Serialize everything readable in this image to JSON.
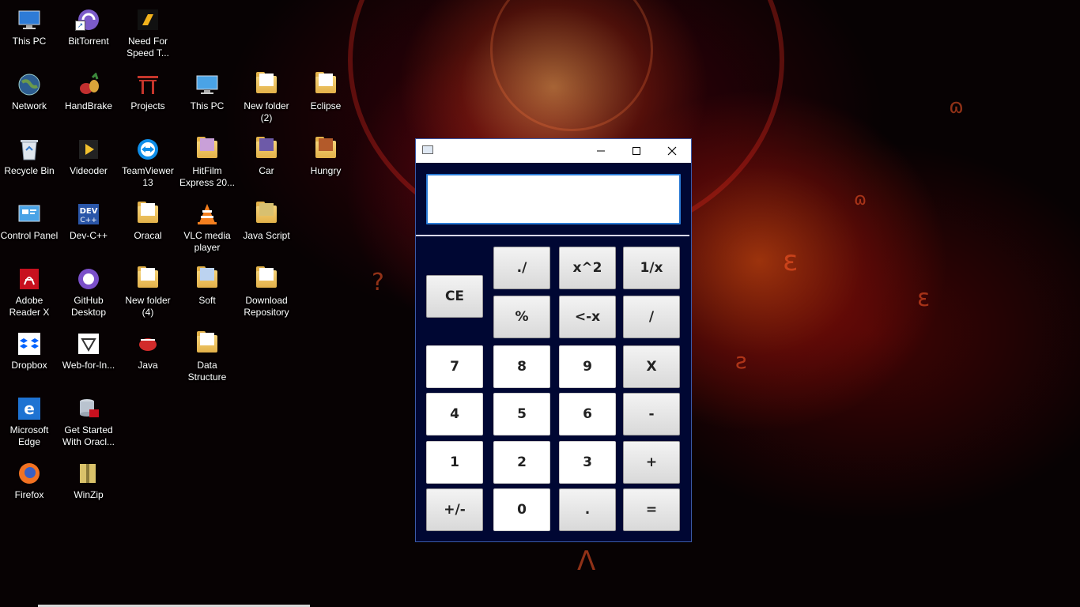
{
  "desktop": {
    "icons": [
      {
        "label": "This PC",
        "icon": "monitor-icon"
      },
      {
        "label": "BitTorrent",
        "icon": "bittorrent-icon"
      },
      {
        "label": "Need For Speed T...",
        "icon": "nfs-icon"
      },
      {
        "label": "Network",
        "icon": "network-globe-icon"
      },
      {
        "label": "HandBrake",
        "icon": "handbrake-icon"
      },
      {
        "label": "Projects",
        "icon": "gate-icon"
      },
      {
        "label": "This PC",
        "icon": "monitor-icon"
      },
      {
        "label": "New folder (2)",
        "icon": "folder-icon"
      },
      {
        "label": "Eclipse",
        "icon": "folder-icon"
      },
      {
        "label": "Recycle Bin",
        "icon": "recycle-bin-icon"
      },
      {
        "label": "Videoder",
        "icon": "videoder-icon"
      },
      {
        "label": "TeamViewer 13",
        "icon": "teamviewer-icon"
      },
      {
        "label": "HitFilm Express 20...",
        "icon": "folder-icon"
      },
      {
        "label": "Car",
        "icon": "folder-icon"
      },
      {
        "label": "Hungry",
        "icon": "folder-icon"
      },
      {
        "label": "Control Panel",
        "icon": "control-panel-icon"
      },
      {
        "label": "Dev-C++",
        "icon": "devcpp-icon"
      },
      {
        "label": "Oracal",
        "icon": "folder-icon"
      },
      {
        "label": "VLC media player",
        "icon": "vlc-icon"
      },
      {
        "label": "Java Script",
        "icon": "folder-icon"
      },
      {
        "label": "Adobe Reader X",
        "icon": "adobe-reader-icon"
      },
      {
        "label": "GitHub Desktop",
        "icon": "github-icon"
      },
      {
        "label": "New folder (4)",
        "icon": "folder-icon"
      },
      {
        "label": "Soft",
        "icon": "folder-icon"
      },
      {
        "label": "Download Repository",
        "icon": "folder-icon"
      },
      {
        "label": "Dropbox",
        "icon": "dropbox-icon"
      },
      {
        "label": "Web-for-In...",
        "icon": "web-app-icon"
      },
      {
        "label": "Java",
        "icon": "java-icon"
      },
      {
        "label": "Data Structure",
        "icon": "folder-icon"
      },
      {
        "label": "Microsoft Edge",
        "icon": "edge-icon"
      },
      {
        "label": "Get Started With Oracl...",
        "icon": "oracle-db-icon"
      },
      {
        "label": "Firefox",
        "icon": "firefox-icon"
      },
      {
        "label": "WinZip",
        "icon": "winzip-icon"
      }
    ]
  },
  "calculator": {
    "title_icons": {
      "minimize": "minimize-icon",
      "maximize": "maximize-icon",
      "close": "close-icon"
    },
    "display": {
      "value": ""
    },
    "keys": {
      "ce": "CE",
      "sqrt": "./",
      "square": "x^2",
      "reciprocal": "1/x",
      "percent": "%",
      "backspace": "<-x",
      "divide": "/",
      "seven": "7",
      "eight": "8",
      "nine": "9",
      "multiply": "X",
      "four": "4",
      "five": "5",
      "six": "6",
      "minus": "-",
      "one": "1",
      "two": "2",
      "three": "3",
      "plus": "+",
      "negate": "+/-",
      "zero": "0",
      "dot": ".",
      "equals": "="
    }
  }
}
